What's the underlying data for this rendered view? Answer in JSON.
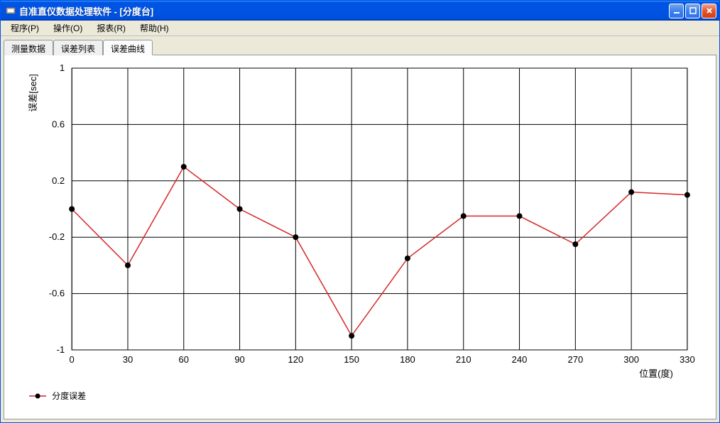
{
  "window": {
    "title": "自准直仪数据处理软件  -  [分度台]"
  },
  "menu": {
    "program": "程序(P)",
    "operate": "操作(O)",
    "report": "报表(R)",
    "help": "帮助(H)"
  },
  "tabs": {
    "measure_data": "测量数据",
    "error_list": "误差列表",
    "error_curve": "误差曲线"
  },
  "chart": {
    "xlabel": "位置(度)",
    "ylabel": "误差[sec]",
    "legend_label": "分度误差"
  },
  "chart_data": {
    "type": "line",
    "title": "",
    "xlabel": "位置(度)",
    "ylabel": "误差[sec]",
    "xlim": [
      0,
      330
    ],
    "ylim": [
      -1,
      1
    ],
    "x_ticks": [
      0,
      30,
      60,
      90,
      120,
      150,
      180,
      210,
      240,
      270,
      300,
      330
    ],
    "y_ticks": [
      -1,
      -0.6,
      -0.2,
      0.2,
      0.6,
      1
    ],
    "grid": true,
    "series": [
      {
        "name": "分度误差",
        "color": "#d62728",
        "marker": "circle",
        "x": [
          0,
          30,
          60,
          90,
          120,
          150,
          180,
          210,
          240,
          270,
          300,
          330
        ],
        "y": [
          0.0,
          -0.4,
          0.3,
          0.0,
          -0.2,
          -0.9,
          -0.35,
          -0.05,
          -0.05,
          -0.25,
          0.12,
          0.1
        ]
      }
    ]
  }
}
